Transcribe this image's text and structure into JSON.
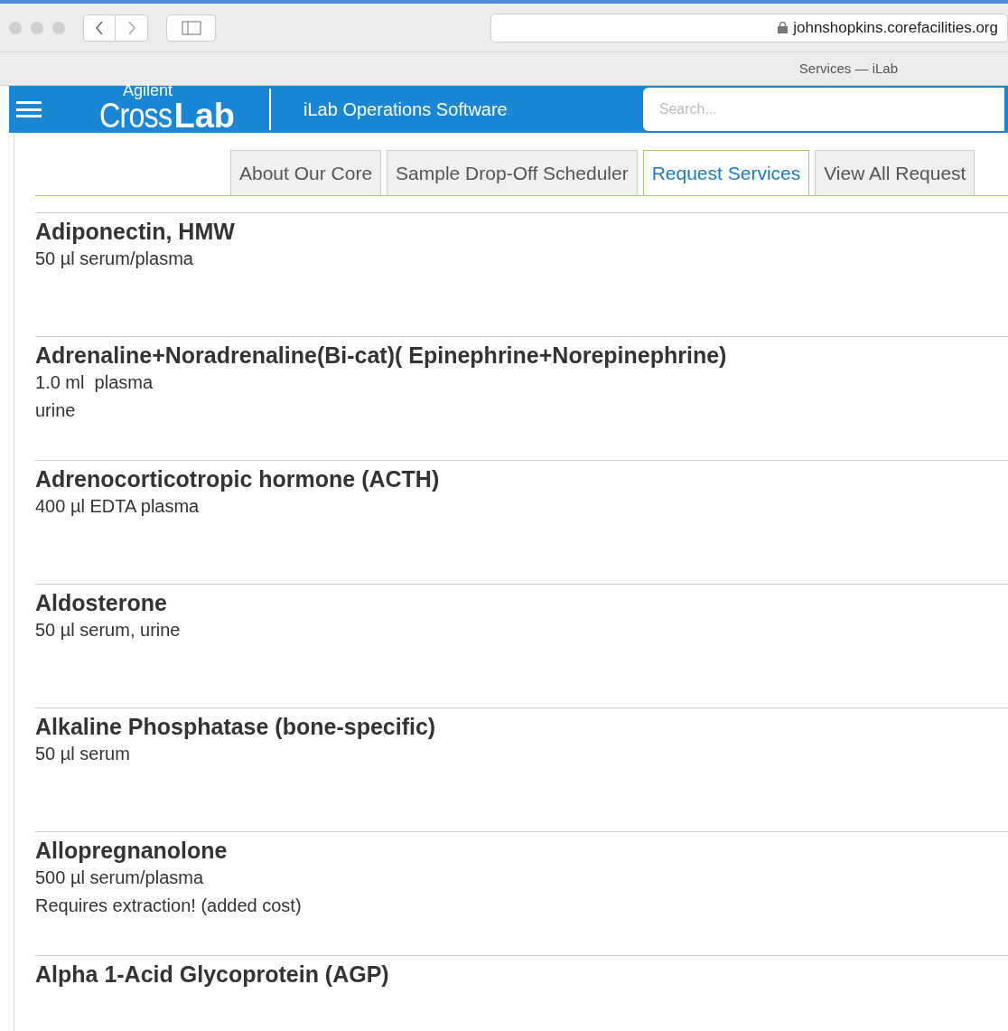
{
  "browser": {
    "url": "johnshopkins.corefacilities.org",
    "tab_title": "Services — iLab"
  },
  "header": {
    "logo_small": "Agilent",
    "logo_light": "Cross",
    "logo_bold": "Lab",
    "product": "iLab Operations Software",
    "search": {
      "placeholder": "Search..."
    }
  },
  "tabs": [
    {
      "label": "About Our Core",
      "selected": false
    },
    {
      "label": "Sample Drop-Off Scheduler",
      "selected": false
    },
    {
      "label": "Request Services",
      "selected": true
    },
    {
      "label": "View All Request",
      "selected": false
    }
  ],
  "services": [
    {
      "name": "Adiponectin, HMW",
      "details": [
        "50 µl serum/plasma"
      ]
    },
    {
      "name": "Adrenaline+Noradrenaline(Bi-cat)( Epinephrine+Norepinephrine)",
      "details": [
        "1.0 ml  plasma",
        "urine"
      ]
    },
    {
      "name": "Adrenocorticotropic hormone (ACTH)",
      "details": [
        "400 µl EDTA plasma"
      ]
    },
    {
      "name": "Aldosterone",
      "details": [
        "50 µl serum, urine"
      ]
    },
    {
      "name": "Alkaline Phosphatase (bone-specific)",
      "details": [
        "50 µl serum"
      ]
    },
    {
      "name": "Allopregnanolone",
      "details": [
        "500 µl serum/plasma",
        "Requires extraction! (added cost)"
      ]
    },
    {
      "name": "Alpha 1-Acid Glycoprotein (AGP)"
    }
  ]
}
